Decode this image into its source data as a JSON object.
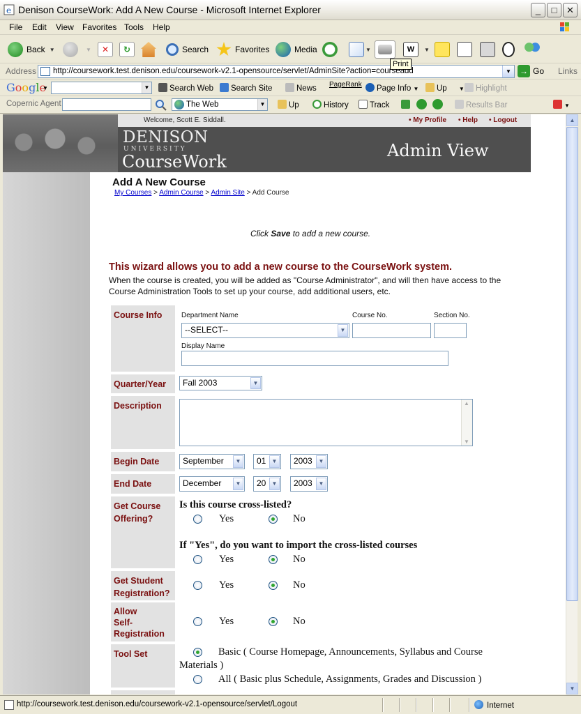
{
  "window": {
    "title": "Denison CourseWork: Add A New Course - Microsoft Internet Explorer"
  },
  "menu": [
    "File",
    "Edit",
    "View",
    "Favorites",
    "Tools",
    "Help"
  ],
  "toolbar": {
    "back": "Back",
    "search": "Search",
    "favorites": "Favorites",
    "media": "Media",
    "tooltip": "Print"
  },
  "address": {
    "label": "Address",
    "url": "http://coursework.test.denison.edu/coursework-v2.1-opensource/servlet/AdminSite?action=courseadd",
    "go": "Go",
    "links": "Links"
  },
  "google": {
    "logo": "Google",
    "search_web": "Search Web",
    "search_site": "Search Site",
    "news": "News",
    "pagerank": "PageRank",
    "page_info": "Page Info",
    "up": "Up",
    "highlight": "Highlight"
  },
  "copernic": {
    "label": "Copernic Agent",
    "scope": "The Web",
    "up": "Up",
    "history": "History",
    "track": "Track",
    "results_bar": "Results Bar"
  },
  "page": {
    "welcome": "Welcome, Scott E. Siddall.",
    "my_profile": "• My Profile",
    "help": "• Help",
    "logout": "• Logout",
    "brand_denison": "DENISON",
    "brand_university": "UNIVERSITY",
    "brand_coursework": "CourseWork",
    "admin_view": "Admin View",
    "title": "Add A New Course",
    "breadcrumb": {
      "my_courses": "My Courses",
      "admin_course": "Admin Course",
      "admin_site": "Admin Site",
      "current": "Add Course",
      "sep": ">"
    },
    "click_pre": "Click",
    "click_bold": "Save",
    "click_post": "to add a new course.",
    "wizard_heading": "This wizard allows you to add a new course to the CourseWork system.",
    "wizard_text": "When the course is created, you will be added as \"Course Administrator\", and will then have access to the Course Administration Tools to set up your course, add additional users, etc."
  },
  "form": {
    "course_info": "Course Info",
    "department_label": "Department Name",
    "department_value": "--SELECT--",
    "course_no_label": "Course No.",
    "section_no_label": "Section No.",
    "display_name_label": "Display Name",
    "quarter_label": "Quarter/Year",
    "quarter_value": "Fall 2003",
    "description_label": "Description",
    "begin_label": "Begin Date",
    "begin_month": "September",
    "begin_day": "01",
    "begin_year": "2003",
    "end_label": "End Date",
    "end_month": "December",
    "end_day": "20",
    "end_year": "2003",
    "offering_label_1": "Get Course",
    "offering_label_2": "Offering?",
    "crosslisted_q": "Is this course cross-listed?",
    "import_q": "If \"Yes\", do you want to import the cross-listed courses",
    "student_label_1": "Get Student",
    "student_label_2": "Registration?",
    "self_label_1": "Allow",
    "self_label_2": "Self-",
    "self_label_3": "Registration",
    "toolset_label": "Tool Set",
    "yes": "Yes",
    "no": "No",
    "basic_line1": "Basic ( Course Homepage, Announcements, Syllabus and Course",
    "basic_line2": "Materials )",
    "all_option": "All ( Basic plus Schedule, Assignments, Grades and Discussion )"
  },
  "status": {
    "url": "http://coursework.test.denison.edu/coursework-v2.1-opensource/servlet/Logout",
    "zone": "Internet"
  }
}
